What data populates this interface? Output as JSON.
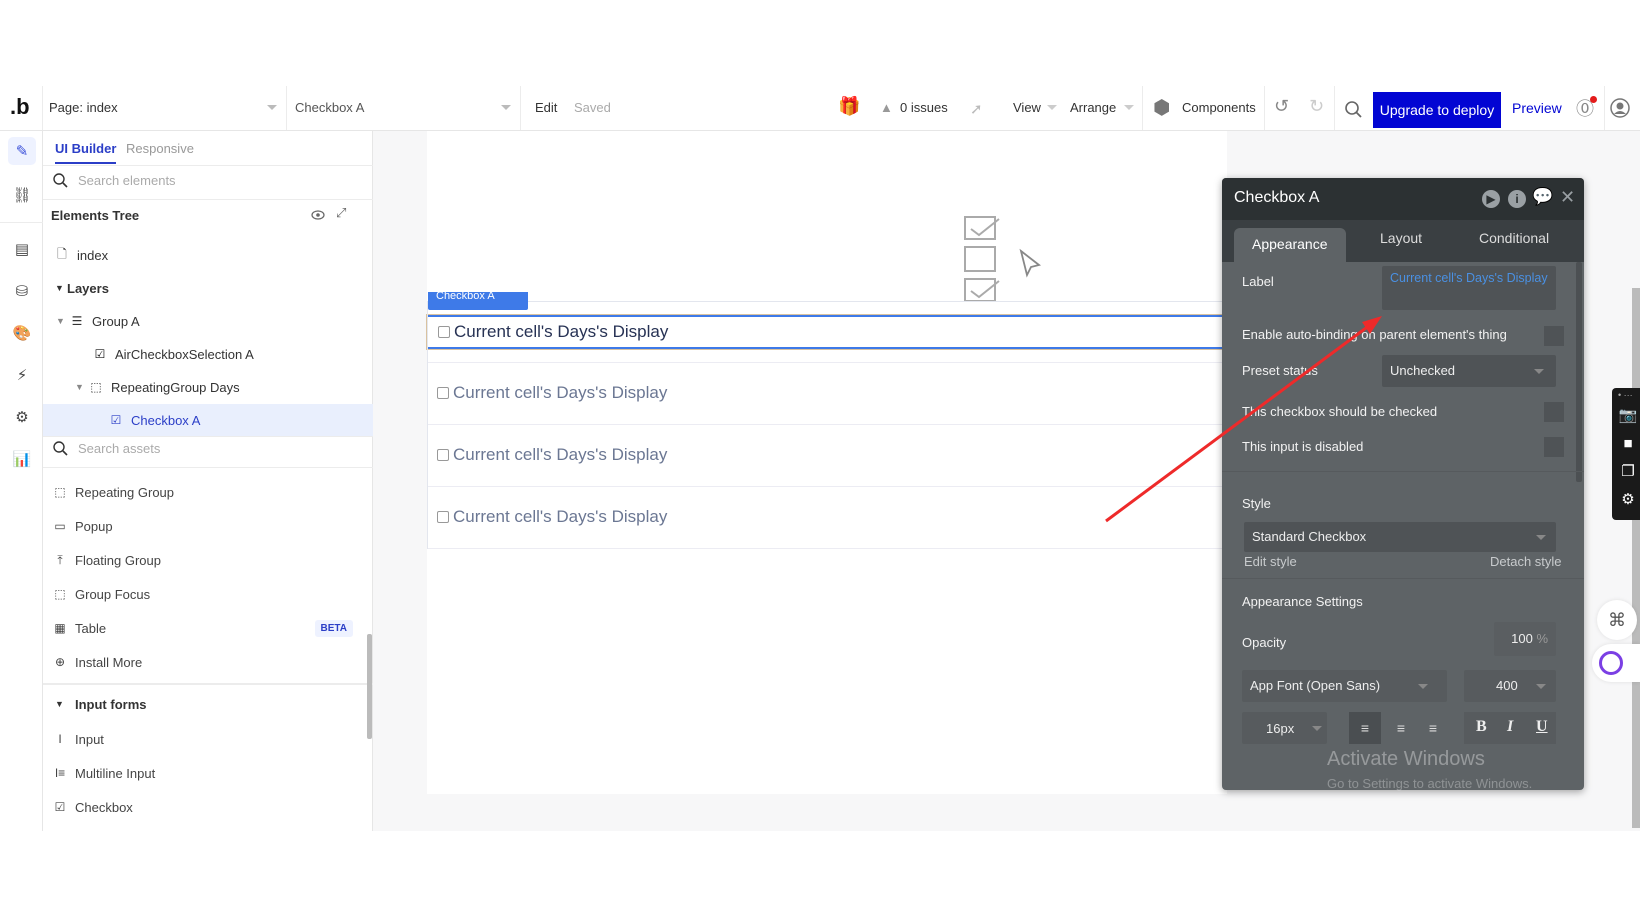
{
  "topbar": {
    "logo": ".b",
    "page_selector": "Page: index",
    "element_selector": "Checkbox A",
    "edit_label": "Edit",
    "saved_label": "Saved",
    "issues_label": "0 issues",
    "view_label": "View",
    "arrange_label": "Arrange",
    "components_label": "Components",
    "upgrade_label": "Upgrade to deploy",
    "preview_label": "Preview",
    "accent_color": "#0205d3"
  },
  "rail": {
    "items": [
      "design",
      "workflow",
      "data",
      "database",
      "styles",
      "plugins",
      "settings",
      "logs"
    ]
  },
  "left_panel": {
    "tabs": [
      {
        "label": "UI Builder",
        "active": true
      },
      {
        "label": "Responsive",
        "active": false
      }
    ],
    "search_elements_placeholder": "Search elements",
    "tree_title": "Elements Tree",
    "tree": [
      {
        "label": "index",
        "icon": "page-icon",
        "level": 0
      },
      {
        "label": "Layers",
        "icon": "",
        "level": 0,
        "expanded": true
      },
      {
        "label": "Group A",
        "icon": "group-icon",
        "level": 1,
        "expanded": true
      },
      {
        "label": "AirCheckboxSelection A",
        "icon": "checkbox-filled-icon",
        "level": 2
      },
      {
        "label": "RepeatingGroup Days",
        "icon": "repeating-group-icon",
        "level": 2,
        "expanded": true
      },
      {
        "label": "Checkbox A",
        "icon": "checkbox-icon",
        "level": 3,
        "selected": true
      }
    ],
    "search_assets_placeholder": "Search assets",
    "assets": [
      {
        "label": "Repeating Group",
        "icon": "repeating-group-icon"
      },
      {
        "label": "Popup",
        "icon": "popup-icon"
      },
      {
        "label": "Floating Group",
        "icon": "floating-group-icon"
      },
      {
        "label": "Group Focus",
        "icon": "group-focus-icon"
      },
      {
        "label": "Table",
        "icon": "table-icon",
        "badge": "BETA"
      },
      {
        "label": "Install More",
        "icon": "plus-circle-icon"
      }
    ],
    "input_forms_title": "Input forms",
    "input_forms": [
      {
        "label": "Input",
        "icon": "input-icon"
      },
      {
        "label": "Multiline Input",
        "icon": "multiline-input-icon"
      },
      {
        "label": "Checkbox",
        "icon": "checkbox-icon"
      }
    ]
  },
  "canvas": {
    "selected_tag": "Checkbox A",
    "rows": [
      "Current cell's Days's Display",
      "Current cell's Days's Display",
      "Current cell's Days's Display",
      "Current cell's Days's Display"
    ]
  },
  "property_editor": {
    "title": "Checkbox A",
    "tabs": [
      {
        "label": "Appearance",
        "active": true
      },
      {
        "label": "Layout",
        "active": false
      },
      {
        "label": "Conditional",
        "active": false
      }
    ],
    "label_label": "Label",
    "label_value": "Current cell's Days's Display",
    "auto_binding_label": "Enable auto-binding on parent element's thing",
    "preset_status_label": "Preset status",
    "preset_status_value": "Unchecked",
    "should_be_checked_label": "This checkbox should be checked",
    "disabled_label": "This input is disabled",
    "style_label": "Style",
    "style_value": "Standard Checkbox",
    "edit_style_label": "Edit style",
    "detach_style_label": "Detach style",
    "appearance_settings_label": "Appearance Settings",
    "opacity_label": "Opacity",
    "opacity_value": "100",
    "opacity_unit": "%",
    "font_value": "App Font (Open Sans)",
    "font_weight_value": "400",
    "font_size_value": "16px",
    "bold_label": "B",
    "italic_label": "I",
    "underline_label": "U",
    "dynamic_text_color": "#4a90e2"
  },
  "watermark": {
    "line1": "Activate Windows",
    "line2": "Go to Settings to activate Windows."
  },
  "annotation": {
    "color": "#ee2a2a"
  }
}
